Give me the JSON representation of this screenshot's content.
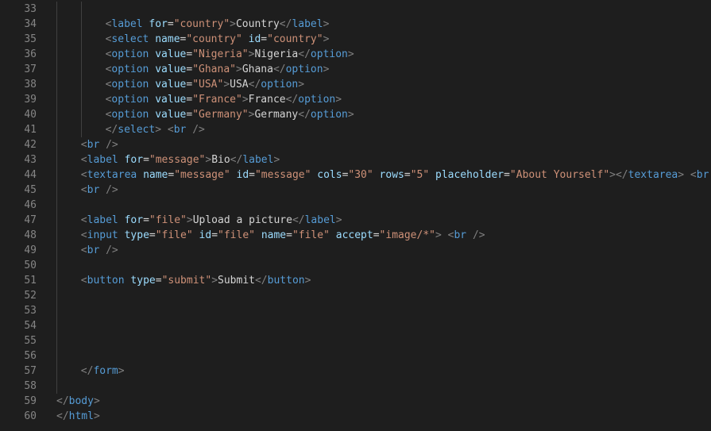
{
  "editor": {
    "language": "html",
    "theme": {
      "background": "#1e1e1e",
      "line_number": "#858585",
      "punctuation": "#808080",
      "tag": "#569cd6",
      "attribute": "#9cdcfe",
      "string": "#ce9178",
      "text": "#d4d4d4"
    },
    "lines": [
      {
        "num": "33",
        "indent": 2,
        "tokens": []
      },
      {
        "num": "34",
        "indent": 2,
        "tokens": [
          [
            "p",
            "<"
          ],
          [
            "t",
            "label"
          ],
          [
            "s",
            " "
          ],
          [
            "a",
            "for"
          ],
          [
            "e",
            "="
          ],
          [
            "v",
            "\"country\""
          ],
          [
            "p",
            ">"
          ],
          [
            "x",
            "Country"
          ],
          [
            "p",
            "</"
          ],
          [
            "t",
            "label"
          ],
          [
            "p",
            ">"
          ]
        ]
      },
      {
        "num": "35",
        "indent": 2,
        "tokens": [
          [
            "p",
            "<"
          ],
          [
            "t",
            "select"
          ],
          [
            "s",
            " "
          ],
          [
            "a",
            "name"
          ],
          [
            "e",
            "="
          ],
          [
            "v",
            "\"country\""
          ],
          [
            "s",
            " "
          ],
          [
            "a",
            "id"
          ],
          [
            "e",
            "="
          ],
          [
            "v",
            "\"country\""
          ],
          [
            "p",
            ">"
          ]
        ]
      },
      {
        "num": "36",
        "indent": 2,
        "tokens": [
          [
            "p",
            "<"
          ],
          [
            "t",
            "option"
          ],
          [
            "s",
            " "
          ],
          [
            "a",
            "value"
          ],
          [
            "e",
            "="
          ],
          [
            "v",
            "\"Nigeria\""
          ],
          [
            "p",
            ">"
          ],
          [
            "x",
            "Nigeria"
          ],
          [
            "p",
            "</"
          ],
          [
            "t",
            "option"
          ],
          [
            "p",
            ">"
          ]
        ]
      },
      {
        "num": "37",
        "indent": 2,
        "tokens": [
          [
            "p",
            "<"
          ],
          [
            "t",
            "option"
          ],
          [
            "s",
            " "
          ],
          [
            "a",
            "value"
          ],
          [
            "e",
            "="
          ],
          [
            "v",
            "\"Ghana\""
          ],
          [
            "p",
            ">"
          ],
          [
            "x",
            "Ghana"
          ],
          [
            "p",
            "</"
          ],
          [
            "t",
            "option"
          ],
          [
            "p",
            ">"
          ]
        ]
      },
      {
        "num": "38",
        "indent": 2,
        "tokens": [
          [
            "p",
            "<"
          ],
          [
            "t",
            "option"
          ],
          [
            "s",
            " "
          ],
          [
            "a",
            "value"
          ],
          [
            "e",
            "="
          ],
          [
            "v",
            "\"USA\""
          ],
          [
            "p",
            ">"
          ],
          [
            "x",
            "USA"
          ],
          [
            "p",
            "</"
          ],
          [
            "t",
            "option"
          ],
          [
            "p",
            ">"
          ]
        ]
      },
      {
        "num": "39",
        "indent": 2,
        "tokens": [
          [
            "p",
            "<"
          ],
          [
            "t",
            "option"
          ],
          [
            "s",
            " "
          ],
          [
            "a",
            "value"
          ],
          [
            "e",
            "="
          ],
          [
            "v",
            "\"France\""
          ],
          [
            "p",
            ">"
          ],
          [
            "x",
            "France"
          ],
          [
            "p",
            "</"
          ],
          [
            "t",
            "option"
          ],
          [
            "p",
            ">"
          ]
        ]
      },
      {
        "num": "40",
        "indent": 2,
        "tokens": [
          [
            "p",
            "<"
          ],
          [
            "t",
            "option"
          ],
          [
            "s",
            " "
          ],
          [
            "a",
            "value"
          ],
          [
            "e",
            "="
          ],
          [
            "v",
            "\"Germany\""
          ],
          [
            "p",
            ">"
          ],
          [
            "x",
            "Germany"
          ],
          [
            "p",
            "</"
          ],
          [
            "t",
            "option"
          ],
          [
            "p",
            ">"
          ]
        ]
      },
      {
        "num": "41",
        "indent": 2,
        "tokens": [
          [
            "p",
            "</"
          ],
          [
            "t",
            "select"
          ],
          [
            "p",
            ">"
          ],
          [
            "s",
            " "
          ],
          [
            "p",
            "<"
          ],
          [
            "t",
            "br"
          ],
          [
            "s",
            " "
          ],
          [
            "p",
            "/>"
          ]
        ]
      },
      {
        "num": "42",
        "indent": 1,
        "tokens": [
          [
            "p",
            "<"
          ],
          [
            "t",
            "br"
          ],
          [
            "s",
            " "
          ],
          [
            "p",
            "/>"
          ]
        ]
      },
      {
        "num": "43",
        "indent": 1,
        "tokens": [
          [
            "p",
            "<"
          ],
          [
            "t",
            "label"
          ],
          [
            "s",
            " "
          ],
          [
            "a",
            "for"
          ],
          [
            "e",
            "="
          ],
          [
            "v",
            "\"message\""
          ],
          [
            "p",
            ">"
          ],
          [
            "x",
            "Bio"
          ],
          [
            "p",
            "</"
          ],
          [
            "t",
            "label"
          ],
          [
            "p",
            ">"
          ]
        ]
      },
      {
        "num": "44",
        "indent": 1,
        "tokens": [
          [
            "p",
            "<"
          ],
          [
            "t",
            "textarea"
          ],
          [
            "s",
            " "
          ],
          [
            "a",
            "name"
          ],
          [
            "e",
            "="
          ],
          [
            "v",
            "\"message\""
          ],
          [
            "s",
            " "
          ],
          [
            "a",
            "id"
          ],
          [
            "e",
            "="
          ],
          [
            "v",
            "\"message\""
          ],
          [
            "s",
            " "
          ],
          [
            "a",
            "cols"
          ],
          [
            "e",
            "="
          ],
          [
            "v",
            "\"30\""
          ],
          [
            "s",
            " "
          ],
          [
            "a",
            "rows"
          ],
          [
            "e",
            "="
          ],
          [
            "v",
            "\"5\""
          ],
          [
            "s",
            " "
          ],
          [
            "a",
            "placeholder"
          ],
          [
            "e",
            "="
          ],
          [
            "v",
            "\"About Yourself\""
          ],
          [
            "p",
            ">"
          ],
          [
            "p",
            "</"
          ],
          [
            "t",
            "textarea"
          ],
          [
            "p",
            ">"
          ],
          [
            "s",
            " "
          ],
          [
            "p",
            "<"
          ],
          [
            "t",
            "br"
          ],
          [
            "s",
            " "
          ],
          [
            "p",
            "/>"
          ]
        ]
      },
      {
        "num": "45",
        "indent": 1,
        "tokens": [
          [
            "p",
            "<"
          ],
          [
            "t",
            "br"
          ],
          [
            "s",
            " "
          ],
          [
            "p",
            "/>"
          ]
        ]
      },
      {
        "num": "46",
        "indent": 1,
        "tokens": []
      },
      {
        "num": "47",
        "indent": 1,
        "tokens": [
          [
            "p",
            "<"
          ],
          [
            "t",
            "label"
          ],
          [
            "s",
            " "
          ],
          [
            "a",
            "for"
          ],
          [
            "e",
            "="
          ],
          [
            "v",
            "\"file\""
          ],
          [
            "p",
            ">"
          ],
          [
            "x",
            "Upload a picture"
          ],
          [
            "p",
            "</"
          ],
          [
            "t",
            "label"
          ],
          [
            "p",
            ">"
          ]
        ]
      },
      {
        "num": "48",
        "indent": 1,
        "tokens": [
          [
            "p",
            "<"
          ],
          [
            "t",
            "input"
          ],
          [
            "s",
            " "
          ],
          [
            "a",
            "type"
          ],
          [
            "e",
            "="
          ],
          [
            "v",
            "\"file\""
          ],
          [
            "s",
            " "
          ],
          [
            "a",
            "id"
          ],
          [
            "e",
            "="
          ],
          [
            "v",
            "\"file\""
          ],
          [
            "s",
            " "
          ],
          [
            "a",
            "name"
          ],
          [
            "e",
            "="
          ],
          [
            "v",
            "\"file\""
          ],
          [
            "s",
            " "
          ],
          [
            "a",
            "accept"
          ],
          [
            "e",
            "="
          ],
          [
            "v",
            "\"image/*\""
          ],
          [
            "p",
            ">"
          ],
          [
            "s",
            " "
          ],
          [
            "p",
            "<"
          ],
          [
            "t",
            "br"
          ],
          [
            "s",
            " "
          ],
          [
            "p",
            "/>"
          ]
        ]
      },
      {
        "num": "49",
        "indent": 1,
        "tokens": [
          [
            "p",
            "<"
          ],
          [
            "t",
            "br"
          ],
          [
            "s",
            " "
          ],
          [
            "p",
            "/>"
          ]
        ]
      },
      {
        "num": "50",
        "indent": 1,
        "tokens": []
      },
      {
        "num": "51",
        "indent": 1,
        "tokens": [
          [
            "p",
            "<"
          ],
          [
            "t",
            "button"
          ],
          [
            "s",
            " "
          ],
          [
            "a",
            "type"
          ],
          [
            "e",
            "="
          ],
          [
            "v",
            "\"submit\""
          ],
          [
            "p",
            ">"
          ],
          [
            "x",
            "Submit"
          ],
          [
            "p",
            "</"
          ],
          [
            "t",
            "button"
          ],
          [
            "p",
            ">"
          ]
        ]
      },
      {
        "num": "52",
        "indent": 1,
        "tokens": []
      },
      {
        "num": "53",
        "indent": 1,
        "tokens": []
      },
      {
        "num": "54",
        "indent": 1,
        "tokens": []
      },
      {
        "num": "55",
        "indent": 1,
        "tokens": []
      },
      {
        "num": "56",
        "indent": 1,
        "tokens": []
      },
      {
        "num": "57",
        "indent": 1,
        "tokens": [
          [
            "p",
            "</"
          ],
          [
            "t",
            "form"
          ],
          [
            "p",
            ">"
          ]
        ]
      },
      {
        "num": "58",
        "indent": 1,
        "tokens": []
      },
      {
        "num": "59",
        "indent": 0,
        "tokens": [
          [
            "p",
            "</"
          ],
          [
            "t",
            "body"
          ],
          [
            "p",
            ">"
          ]
        ]
      },
      {
        "num": "60",
        "indent": 0,
        "tokens": [
          [
            "p",
            "</"
          ],
          [
            "t",
            "html"
          ],
          [
            "p",
            ">"
          ]
        ]
      }
    ]
  }
}
